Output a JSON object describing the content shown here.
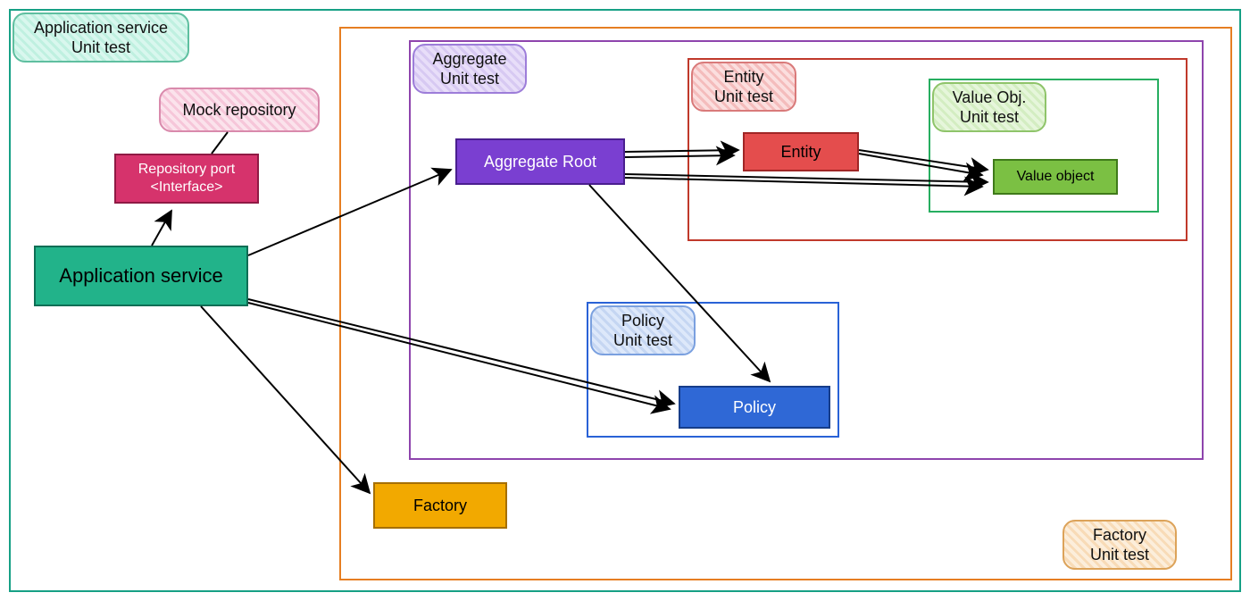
{
  "frames": {
    "app_test": {
      "label": "Application service\nUnit test"
    },
    "aggregate_test": {
      "label": "Aggregate\nUnit test"
    },
    "entity_test": {
      "label": "Entity\nUnit test"
    },
    "value_test": {
      "label": "Value Obj.\nUnit test"
    },
    "policy_test": {
      "label": "Policy\nUnit test"
    },
    "factory_test": {
      "label": "Factory\nUnit test"
    }
  },
  "nodes": {
    "app_service": {
      "label": "Application service"
    },
    "repo_port": {
      "label": "Repository port\n<Interface>"
    },
    "mock_repo": {
      "label": "Mock repository"
    },
    "aggregate_root": {
      "label": "Aggregate Root"
    },
    "entity": {
      "label": "Entity"
    },
    "value_object": {
      "label": "Value object"
    },
    "policy": {
      "label": "Policy"
    },
    "factory": {
      "label": "Factory"
    }
  },
  "edges": [
    {
      "from": "app_service",
      "to": "repo_port"
    },
    {
      "from": "repo_port",
      "to": "mock_repo",
      "style": "plain"
    },
    {
      "from": "app_service",
      "to": "aggregate_root"
    },
    {
      "from": "app_service",
      "to": "policy"
    },
    {
      "from": "app_service",
      "to": "factory"
    },
    {
      "from": "aggregate_root",
      "to": "entity"
    },
    {
      "from": "aggregate_root",
      "to": "value_object"
    },
    {
      "from": "aggregate_root",
      "to": "policy"
    },
    {
      "from": "entity",
      "to": "value_object"
    }
  ]
}
